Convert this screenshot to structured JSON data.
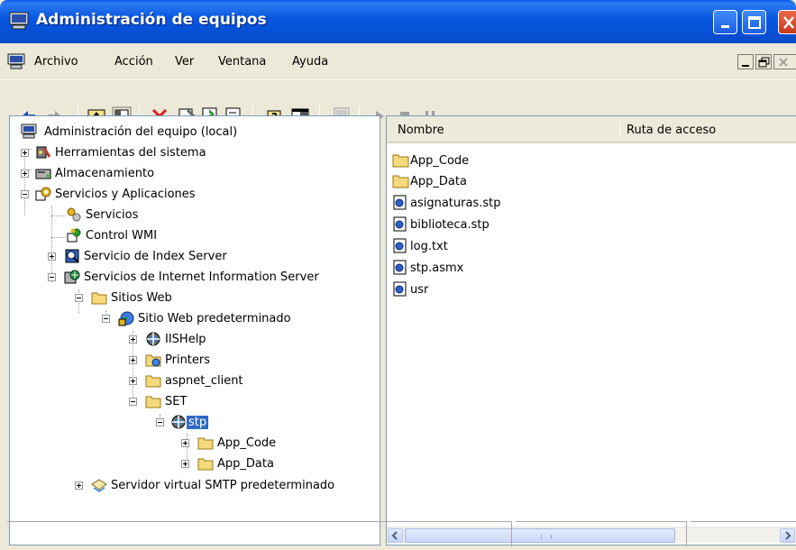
{
  "window": {
    "title": "Administración de equipos"
  },
  "menu": {
    "items": [
      "Archivo",
      "Acción",
      "Ver",
      "Ventana",
      "Ayuda"
    ]
  },
  "toolbar": {
    "buttons": [
      "back-icon",
      "forward-icon",
      "up-folder-icon",
      "show-tree-icon",
      "delete-icon",
      "properties-icon",
      "refresh-icon",
      "export-icon",
      "help-icon",
      "action-pane-icon",
      "computer-icon",
      "play-icon",
      "stop-icon",
      "pause-icon"
    ]
  },
  "tree": {
    "root": "Administración del equipo (local)",
    "system_tools": "Herramientas del sistema",
    "storage": "Almacenamiento",
    "services_apps": "Servicios y Aplicaciones",
    "services": "Servicios",
    "wmi": "Control WMI",
    "index_server": "Servicio de Index Server",
    "iis": "Servicios de Internet Information Server",
    "websites": "Sitios Web",
    "default_site": "Sitio Web predeterminado",
    "iishelp": "IISHelp",
    "printers": "Printers",
    "aspnet_client": "aspnet_client",
    "set": "SET",
    "stp": "stp",
    "app_code": "App_Code",
    "app_data": "App_Data",
    "smtp": "Servidor virtual SMTP predeterminado"
  },
  "list": {
    "columns": [
      "Nombre",
      "Ruta de acceso"
    ],
    "items": [
      {
        "name": "App_Code",
        "icon": "folder-icon"
      },
      {
        "name": "App_Data",
        "icon": "folder-icon"
      },
      {
        "name": "asignaturas.stp",
        "icon": "file-icon"
      },
      {
        "name": "biblioteca.stp",
        "icon": "file-icon"
      },
      {
        "name": "log.txt",
        "icon": "file-icon"
      },
      {
        "name": "stp.asmx",
        "icon": "file-icon"
      },
      {
        "name": "usr",
        "icon": "file-icon"
      }
    ]
  },
  "colors": {
    "titlebar": "#0A58E0",
    "selection": "#316AC5",
    "window_bg": "#ECE9D8"
  }
}
